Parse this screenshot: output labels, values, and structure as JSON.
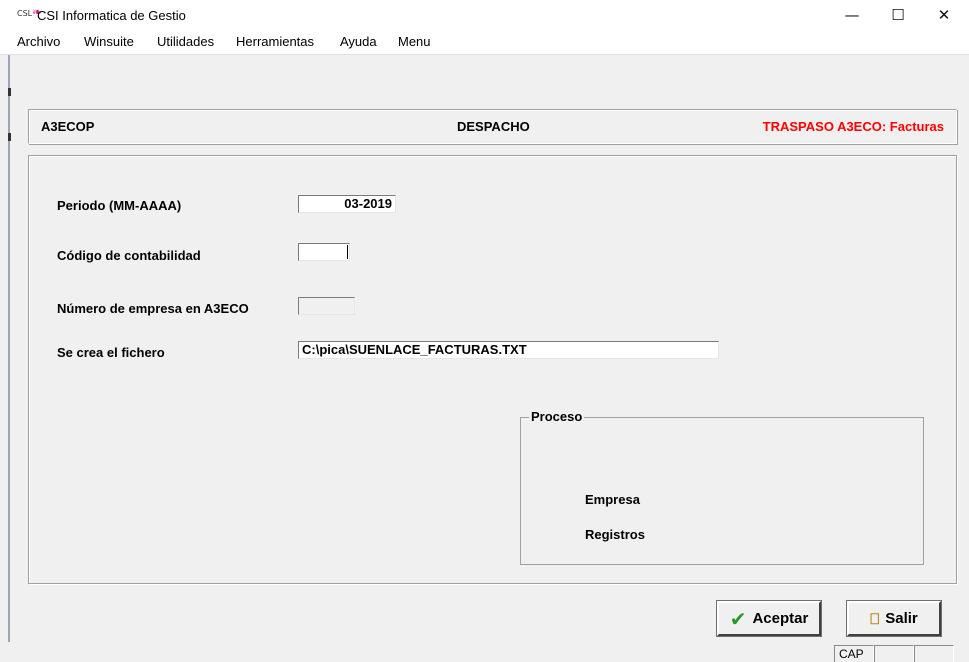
{
  "window": {
    "app_icon_text": "CSL",
    "title": "CSI Informatica de Gestio",
    "minimize_glyph": "—",
    "maximize_glyph": "☐",
    "close_glyph": "✕"
  },
  "menu": [
    "Archivo",
    "Winsuite",
    "Utilidades",
    "Herramientas",
    "Ayuda",
    "Menu"
  ],
  "header": {
    "left": "A3ECOP",
    "center": "DESPACHO",
    "right": "TRASPASO A3ECO: Facturas",
    "right_color": "#ff0000"
  },
  "form": {
    "periodo_label": "Periodo (MM-AAAA)",
    "periodo_value": "03-2019",
    "codigo_label": "Código de contabilidad",
    "codigo_value": "",
    "empresa_label": "Número de empresa en A3ECO",
    "empresa_value": "",
    "fichero_label": "Se crea el fichero",
    "fichero_value": "C:\\pica\\SUENLACE_FACTURAS.TXT"
  },
  "proceso": {
    "title": "Proceso",
    "empresa_label": "Empresa",
    "registros_label": "Registros"
  },
  "buttons": {
    "aceptar": "Aceptar",
    "aceptar_icon": "checkmark-icon",
    "salir": "Salir",
    "salir_icon": "exit-door-icon"
  },
  "status": {
    "cap": "CAP"
  }
}
